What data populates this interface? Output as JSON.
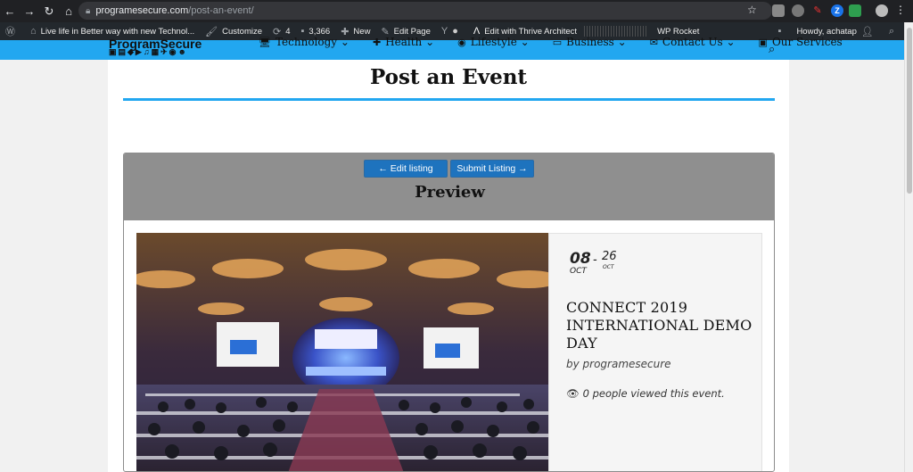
{
  "browser": {
    "url_host": "programesecure.com",
    "url_path": "/post-an-event/"
  },
  "admin_bar": {
    "site_name": "Live life in Better way with new Technol...",
    "customize": "Customize",
    "updates": "4",
    "comments": "3,366",
    "new": "New",
    "edit_page": "Edit Page",
    "thrive": "Edit with Thrive Architect",
    "rocket": "WP Rocket",
    "howdy": "Howdy, achatap"
  },
  "site_nav": {
    "logo": "ProgramSecure",
    "items": [
      "Technology",
      "Health",
      "Lifestyle",
      "Business",
      "Contact Us",
      "Our Services"
    ]
  },
  "page": {
    "title": "Post an Event",
    "edit_button": "← Edit listing",
    "submit_button": "Submit Listing →",
    "preview_title": "Preview"
  },
  "event": {
    "start_day": "08",
    "start_month": "OCT",
    "date_sep": "-",
    "end_day": "26",
    "end_month": "OCT",
    "title": "CONNECT 2019 INTERNATIONAL DEMO DAY",
    "by": "by programesecure",
    "views": "0 people viewed this event."
  },
  "colors": {
    "accent": "#22a7f0",
    "button": "#1e73be",
    "preview_header": "#8f8f8f"
  }
}
